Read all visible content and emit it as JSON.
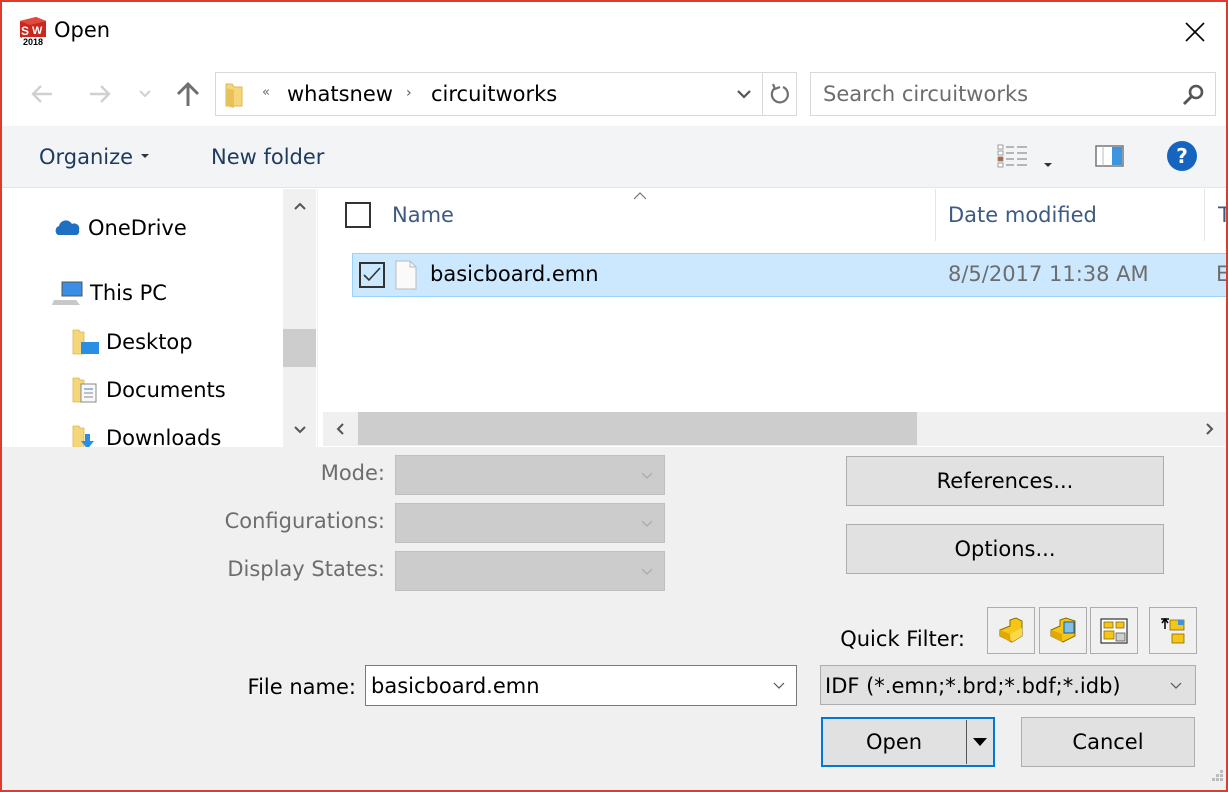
{
  "window": {
    "title": "Open",
    "app_icon": "solidworks-2018-icon",
    "border_color": "#e1392b"
  },
  "nav": {
    "back_icon": "arrow-left-icon",
    "forward_icon": "arrow-right-icon",
    "recent_icon": "chevron-down-icon",
    "up_icon": "arrow-up-icon"
  },
  "address": {
    "overflow_glyph": "«",
    "crumbs": [
      "whatsnew",
      "circuitworks"
    ],
    "separator": "›"
  },
  "search": {
    "placeholder": "Search circuitworks",
    "value": ""
  },
  "toolbar": {
    "organize_label": "Organize",
    "new_folder_label": "New folder",
    "help_glyph": "?"
  },
  "navpane": {
    "items": [
      {
        "label": "OneDrive",
        "icon": "onedrive-cloud-icon",
        "level": 0
      },
      {
        "label": "This PC",
        "icon": "computer-icon",
        "level": 0
      },
      {
        "label": "Desktop",
        "icon": "desktop-folder-icon",
        "level": 1
      },
      {
        "label": "Documents",
        "icon": "documents-folder-icon",
        "level": 1
      },
      {
        "label": "Downloads",
        "icon": "downloads-folder-icon",
        "level": 1
      }
    ]
  },
  "filelist": {
    "columns": [
      "Name",
      "Date modified",
      "T"
    ],
    "sorted_column": "Name",
    "rows": [
      {
        "name": "basicboard.emn",
        "date_modified": "8/5/2017 11:38 AM",
        "type_partial": "E",
        "selected": true,
        "checked": true
      }
    ]
  },
  "options": {
    "mode_label": "Mode:",
    "configurations_label": "Configurations:",
    "display_states_label": "Display States:",
    "mode_value": "",
    "configurations_value": "",
    "display_states_value": "",
    "references_label": "References...",
    "options_label": "Options...",
    "quick_filter_label": "Quick Filter:",
    "quick_filters": [
      {
        "name": "filter-parts",
        "icon": "part-icon"
      },
      {
        "name": "filter-assemblies",
        "icon": "assembly-icon"
      },
      {
        "name": "filter-drawings",
        "icon": "drawing-icon"
      },
      {
        "name": "filter-top-level-assemblies",
        "icon": "top-level-assembly-icon"
      }
    ]
  },
  "footer": {
    "file_name_label": "File name:",
    "file_name_value": "basicboard.emn",
    "file_type_value": "IDF (*.emn;*.brd;*.bdf;*.idb)",
    "open_label": "Open",
    "cancel_label": "Cancel"
  }
}
